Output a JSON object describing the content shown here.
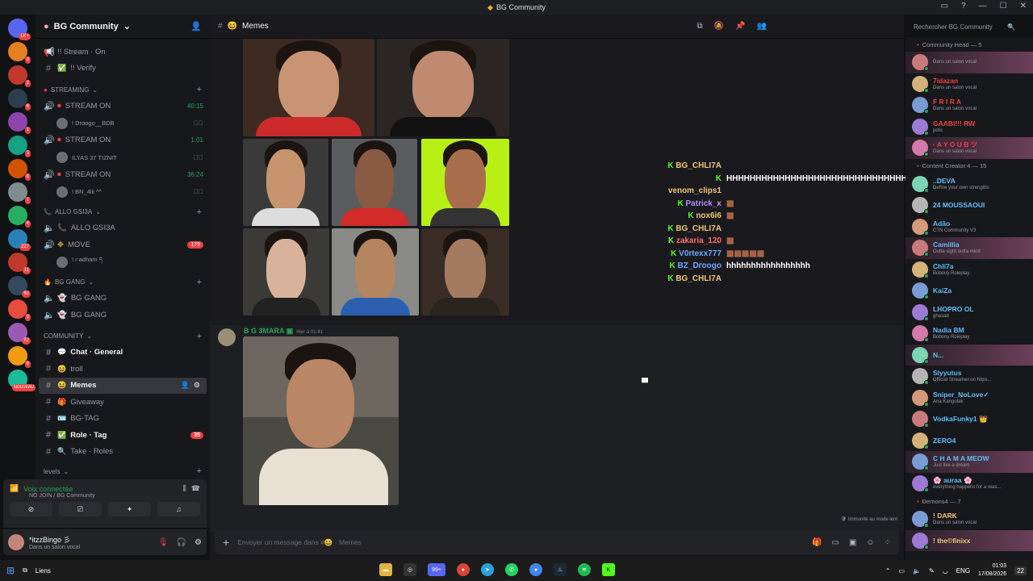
{
  "window": {
    "title": "BG Community"
  },
  "server_rail": {
    "badges": [
      "1K+",
      "3",
      "2",
      "4",
      "1",
      "3",
      "8",
      "1",
      "4",
      "227",
      "11",
      "62",
      "3",
      "52",
      "6",
      "NOUVEAU"
    ]
  },
  "guild": {
    "name": "BG Community"
  },
  "channels": {
    "top": [
      {
        "name": "!! Stream · On",
        "icon": "megaphone-icon"
      },
      {
        "name": "!! Verify",
        "icon": "check-icon"
      }
    ],
    "streaming_cat": "STREAMING",
    "streams": [
      {
        "name": "STREAM ON",
        "time": "40:15",
        "user": "! Droogo__BDB"
      },
      {
        "name": "STREAM ON",
        "time": "1:01",
        "user": "ILYAS 37 TIZNIT"
      },
      {
        "name": "STREAM ON",
        "time": "36:24",
        "user": "! BN_4lii ^^"
      }
    ],
    "allo_cat": "ALLO GSI3A",
    "allo": {
      "name": "ALLO GSI3A"
    },
    "move": {
      "name": "MOVE",
      "count": "179",
      "user": "! ɾ adham ད"
    },
    "bg_gang_cat": "BG GANG",
    "bg_gang": [
      "BG GANG",
      "BG GANG"
    ],
    "community_cat": "COMMUNITY",
    "community": [
      {
        "name": "Chat · General",
        "emo": "💬",
        "bold": true
      },
      {
        "name": "troll",
        "emo": "😆",
        "bold": false
      },
      {
        "name": "Memes",
        "emo": "😆",
        "bold": true,
        "selected": true
      },
      {
        "name": "Giveaway",
        "emo": "🎁",
        "bold": false
      },
      {
        "name": "BG-TAG",
        "emo": "🪪",
        "bold": false
      },
      {
        "name": "Role · Tag",
        "emo": "✅",
        "bold": true,
        "count": "35"
      },
      {
        "name": "Take · Roles",
        "emo": "🔍",
        "bold": false
      }
    ],
    "levels_cat": "levels"
  },
  "voice": {
    "status": "Voix connectée",
    "sub": "NO JOIN / BG Community"
  },
  "user": {
    "name": "*itzzBingo 彡",
    "status": "Dans un salon vocal"
  },
  "header": {
    "channel": "Memes",
    "search_placeholder": "Rechercher BG Community"
  },
  "stream_chat": [
    {
      "n": "BG_CHLI7A",
      "t": "",
      "c": "#f0c674"
    },
    {
      "n": "venom_clips1",
      "t": "HHHHHHHHHHHHHHHHHHHHHHHHHHHHHHHHHHHHHHHHHHHHHHHHH",
      "c": "#f0c674"
    },
    {
      "n": "Patrick_x",
      "t": "▩",
      "c": "#b48cff"
    },
    {
      "n": "nox6i6",
      "t": "▩",
      "c": "#f0c674"
    },
    {
      "n": "BG_CHLI7A",
      "t": "",
      "c": "#f0c674"
    },
    {
      "n": "zakaria_120",
      "t": "▩",
      "c": "#ff6b6b"
    },
    {
      "n": "V0rtexx777",
      "t": "▩▩▩▩▩",
      "c": "#6aa9ff"
    },
    {
      "n": "BZ_Droogo",
      "t": "hhhhhhhhhhhhhhhhh",
      "c": "#6aa9ff"
    },
    {
      "n": "BG_CHLI7A",
      "t": "",
      "c": "#f0c674"
    }
  ],
  "message": {
    "author": "B G 3MARA",
    "time": "Hier à 01:41"
  },
  "slow_mode": "Immunité au mode lent",
  "composer": {
    "placeholder": "Envoyer un message dans #😆 · Memes"
  },
  "members": {
    "groups": [
      {
        "title": "Community Head — 5",
        "items": [
          {
            "name": "",
            "sub": "Dans un salon vocal",
            "color": "#f23f42",
            "hl": true
          },
          {
            "name": "7idazan",
            "sub": "Dans un salon vocal",
            "color": "#f23f42"
          },
          {
            "name": "F R I R A",
            "sub": "Dans un salon vocal",
            "color": "#f23f42"
          },
          {
            "name": "GAABI!!! RW",
            "sub": "poto",
            "color": "#f23f42"
          },
          {
            "name": "· A Y O U B ツ",
            "sub": "Dans un salon vocal",
            "color": "#f23f42",
            "hl": true
          }
        ]
      },
      {
        "title": "Content Creator 4 — 15",
        "items": [
          {
            "name": "..DEVA",
            "sub": "Define your own strengths",
            "color": "#5bc0ff"
          },
          {
            "name": "24 MOUSSAOUI",
            "sub": "",
            "color": "#5bc0ff"
          },
          {
            "name": "Adão",
            "sub": "CTN Community V3",
            "color": "#5bc0ff"
          },
          {
            "name": "Camillia",
            "sub": "Outta sight outta mind",
            "color": "#5bc0ff",
            "hl": true
          },
          {
            "name": "Chli7a",
            "sub": "Bobony Roleplay",
            "color": "#5bc0ff"
          },
          {
            "name": "KaiZa",
            "sub": "",
            "color": "#5bc0ff"
          },
          {
            "name": "LHOPRO OL",
            "sub": "ghasad",
            "color": "#5bc0ff"
          },
          {
            "name": "Nadia BM",
            "sub": "Bobony Roleplay",
            "color": "#5bc0ff"
          },
          {
            "name": "N...",
            "sub": "",
            "color": "#5bc0ff",
            "hl": true
          },
          {
            "name": "Slyyutus",
            "sub": "Official Streamer on https...",
            "color": "#5bc0ff"
          },
          {
            "name": "Sniper_NoLove✓",
            "sub": "Ana Kangolak",
            "color": "#5bc0ff"
          },
          {
            "name": "VodkaFunky1 👑",
            "sub": "",
            "color": "#5bc0ff"
          },
          {
            "name": "ZERO4",
            "sub": "",
            "color": "#5bc0ff"
          },
          {
            "name": "C H A M A  MEOW",
            "sub": "Just like a dream",
            "color": "#5bc0ff",
            "hl": true
          },
          {
            "name": "🌸 auraa 🌸",
            "sub": "everything happens for a reas...",
            "color": "#5bc0ff"
          }
        ]
      },
      {
        "title": "Demons4 — 7",
        "items": [
          {
            "name": "! DARK",
            "sub": "Dans un salon vocal",
            "color": "#f0c674"
          },
          {
            "name": "! the©finixx",
            "sub": "",
            "color": "#f0c674",
            "hl": true
          }
        ]
      }
    ]
  },
  "taskbar": {
    "search": "Liens",
    "lang": "ENG",
    "time": "01:03",
    "date": "17/08/2026",
    "discord_badge": "99+",
    "notif": "22"
  }
}
